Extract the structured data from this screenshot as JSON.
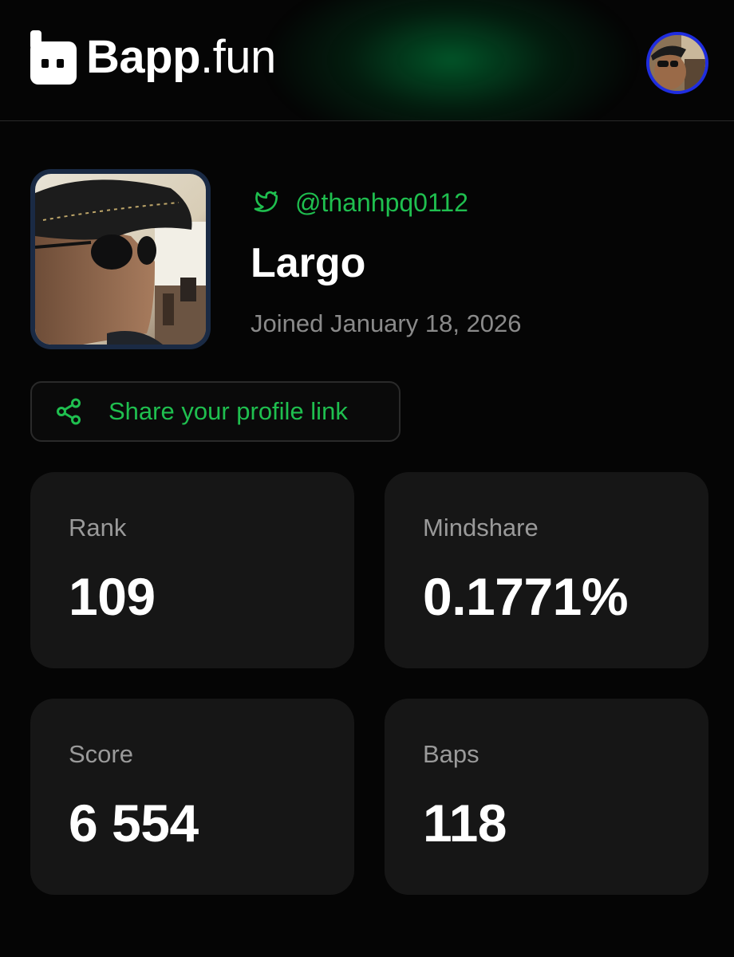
{
  "header": {
    "brand": "Bapp",
    "tld": ".fun",
    "accent_glow": "#009646",
    "avatar_ring_color": "#1f2de0"
  },
  "profile": {
    "handle": "@thanhpq0112",
    "display_name": "Largo",
    "joined": "Joined January 18, 2026",
    "handle_icon": "twitter-bird-icon"
  },
  "share": {
    "label": "Share your profile link",
    "icon": "share-icon"
  },
  "stats": {
    "rank": {
      "label": "Rank",
      "value": "109"
    },
    "mindshare": {
      "label": "Mindshare",
      "value": "0.1771%"
    },
    "score": {
      "label": "Score",
      "value": "6 554"
    },
    "baps": {
      "label": "Baps",
      "value": "118"
    }
  },
  "colors": {
    "accent_green": "#1fbf4f",
    "card_bg": "#161616",
    "muted_text": "#8a8a8a"
  }
}
